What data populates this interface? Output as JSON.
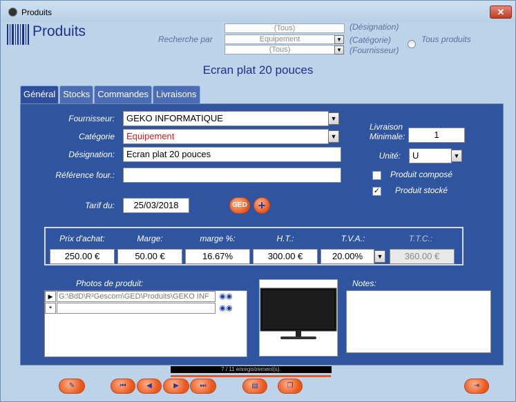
{
  "window": {
    "title": "Produits"
  },
  "header": {
    "app_title": "Produits",
    "search_label": "Recherche par",
    "search_designation": "(Tous)",
    "search_category": "Equipement",
    "search_supplier": "(Tous)",
    "hint_designation": "(Désignation)",
    "hint_category": "(Catégorie)",
    "hint_supplier": "(Fournisseur)",
    "all_products_label": "Tous produits"
  },
  "product_name": "Ecran plat 20 pouces",
  "tabs": [
    {
      "label": "Général"
    },
    {
      "label": "Stocks"
    },
    {
      "label": "Commandes"
    },
    {
      "label": "Livraisons"
    }
  ],
  "general": {
    "supplier_label": "Fournisseur:",
    "supplier_value": "GEKO INFORMATIQUE",
    "category_label": "Catégorie",
    "category_value": "Equipement",
    "category_color": "#d21b1b",
    "designation_label": "Désignation:",
    "designation_value": "Ecran plat 20 pouces",
    "ref_label": "Référence four.:",
    "ref_value": "",
    "tariff_label": "Tarif du:",
    "tariff_value": "25/03/2018",
    "ged_label": "GED",
    "add_label": "+",
    "min_delivery_label_1": "Livraison",
    "min_delivery_label_2": "Minimale:",
    "min_delivery_value": "1",
    "unit_label": "Unité:",
    "unit_value": "U",
    "composed_label": "Produit composé",
    "stocked_label": "Produit stocké",
    "stocked_check": "✓"
  },
  "prices": {
    "headers": [
      "Prix d'achat:",
      "Marge:",
      "marge %:",
      "H.T.:",
      "T.V.A.:",
      "T.T.C.:"
    ],
    "values": [
      "250.00 €",
      "50.00 €",
      "16.67%",
      "300.00 €",
      "20.00%",
      "360.00 €"
    ]
  },
  "photos": {
    "label": "Photos de produit:",
    "row_path": "G:\\BdD\\R²Gescom\\GED\\Produits\\GEKO INF",
    "current_marker": "▶",
    "new_marker": "*"
  },
  "notes_label": "Notes:",
  "status": {
    "text": "7 / 11 enregistrement(s).",
    "progress": 0.64
  },
  "icons": [
    "app-icon",
    "close-icon",
    "barcode-icon",
    "binoculars-icon",
    "first-record-icon",
    "prev-record-icon",
    "next-record-icon",
    "last-record-icon",
    "new-record-icon",
    "copy-record-icon",
    "exit-icon",
    "edit-icon"
  ],
  "colors": {
    "accent": "#e8571d",
    "panel": "#2f54a0",
    "title": "#1e2f8c"
  }
}
